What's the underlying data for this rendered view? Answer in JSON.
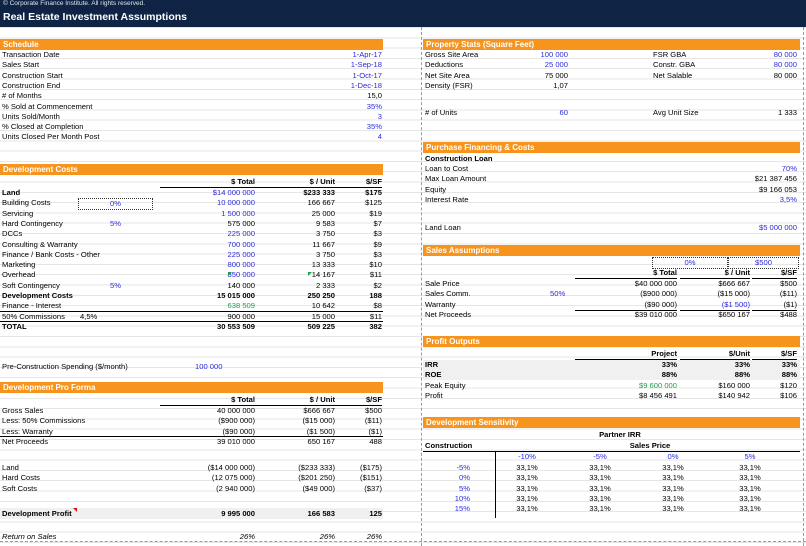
{
  "header": {
    "copyright": "© Corporate Finance Institute. All rights reserved.",
    "title": "Real Estate Investment Assumptions"
  },
  "schedule": {
    "title": "Schedule",
    "rows": [
      {
        "label": "Transaction Date",
        "value": "1-Apr-17",
        "blue": true
      },
      {
        "label": "Sales Start",
        "value": "1-Sep-18",
        "blue": true
      },
      {
        "label": "Construction Start",
        "value": "1-Oct-17",
        "blue": true
      },
      {
        "label": "Construction End",
        "value": "1-Dec-18",
        "blue": true
      },
      {
        "label": "# of Months",
        "value": "15,0",
        "blue": false
      },
      {
        "label": "% Sold at Commencement",
        "value": "35%",
        "blue": true
      },
      {
        "label": "Units Sold/Month",
        "value": "3",
        "blue": true
      },
      {
        "label": "% Closed at Completion",
        "value": "35%",
        "blue": true
      },
      {
        "label": "Units Closed Per Month Post",
        "value": "4",
        "blue": true
      }
    ]
  },
  "dev_costs": {
    "title": "Development Costs",
    "headers": [
      "$ Total",
      "$ / Unit",
      "$/SF"
    ],
    "land": {
      "label": "Land",
      "total": "$14 000 000",
      "unit": "$233 333",
      "sf": "$175"
    },
    "rows": [
      {
        "label": "Building Costs",
        "pct": "0%",
        "total": "10 000 000",
        "unit": "166 667",
        "sf": "$125",
        "blue": true
      },
      {
        "label": "Servicing",
        "pct": "",
        "total": "1 500 000",
        "unit": "25 000",
        "sf": "$19",
        "blue": true
      },
      {
        "label": "Hard Contingency",
        "pct": "5%",
        "total": "575 000",
        "unit": "9 583",
        "sf": "$7",
        "blue": false
      },
      {
        "label": "DCCs",
        "pct": "",
        "total": "225 000",
        "unit": "3 750",
        "sf": "$3",
        "blue": true
      },
      {
        "label": "Consulting & Warranty",
        "pct": "",
        "total": "700 000",
        "unit": "11 667",
        "sf": "$9",
        "blue": true
      },
      {
        "label": "Finance / Bank Costs - Other",
        "pct": "",
        "total": "225 000",
        "unit": "3 750",
        "sf": "$3",
        "blue": true
      },
      {
        "label": "Marketing",
        "pct": "",
        "total": "800 000",
        "unit": "13 333",
        "sf": "$10",
        "blue": true
      },
      {
        "label": "Overhead",
        "pct": "",
        "total": "850 000",
        "unit": "14 167",
        "sf": "$11",
        "blue": true
      },
      {
        "label": "Soft Contingency",
        "pct": "5%",
        "total": "140 000",
        "unit": "2 333",
        "sf": "$2",
        "blue": false
      }
    ],
    "dev_total": {
      "label": "Development Costs",
      "total": "15 015 000",
      "unit": "250 250",
      "sf": "188"
    },
    "finance": {
      "label": "Finance - Interest",
      "total": "638 509",
      "unit": "10 642",
      "sf": "$8"
    },
    "commissions": {
      "label": "50% Commissions",
      "pct": "4,5%",
      "total": "900 000",
      "unit": "15 000",
      "sf": "$11"
    },
    "total": {
      "label": "TOTAL",
      "total": "30 553 509",
      "unit": "509 225",
      "sf": "382"
    },
    "pre_construction": {
      "label": "Pre-Construction Spending ($/month)",
      "value": "100 000"
    }
  },
  "pro_forma": {
    "title": "Development Pro Forma",
    "headers": [
      "$ Total",
      "$ / Unit",
      "$/SF"
    ],
    "rows": [
      {
        "label": "Gross Sales",
        "total": "40 000 000",
        "unit": "$666 667",
        "sf": "$500"
      },
      {
        "label": "Less: 50% Commissions",
        "total": "($900 000)",
        "unit": "($15 000)",
        "sf": "($11)"
      },
      {
        "label": "Less: Warranty",
        "total": "($90 000)",
        "unit": "($1 500)",
        "sf": "($1)"
      },
      {
        "label": "Net Proceeds",
        "total": "39 010 000",
        "unit": "650 167",
        "sf": "488"
      }
    ],
    "costs": [
      {
        "label": "Land",
        "total": "($14 000 000)",
        "unit": "($233 333)",
        "sf": "($175)"
      },
      {
        "label": "Hard Costs",
        "total": "(12 075 000)",
        "unit": "($201 250)",
        "sf": "($151)"
      },
      {
        "label": "Soft Costs",
        "total": "(2 940 000)",
        "unit": "($49 000)",
        "sf": "($37)"
      }
    ],
    "profit": {
      "label": "Development Profit",
      "total": "9 995 000",
      "unit": "166 583",
      "sf": "125"
    },
    "ros": {
      "label": "Return on Sales",
      "total": "26%",
      "unit": "26%",
      "sf": "26%"
    }
  },
  "property": {
    "title": "Property Stats (Square Feet)",
    "left": [
      {
        "label": "Gross Site Area",
        "value": "100 000",
        "blue": true
      },
      {
        "label": "Deductions",
        "value": "25 000",
        "blue": true
      },
      {
        "label": "Net Site Area",
        "value": "75 000",
        "blue": false
      },
      {
        "label": "Density (FSR)",
        "value": "1,07",
        "blue": false
      }
    ],
    "right": [
      {
        "label": "FSR GBA",
        "value": "80 000",
        "blue": true
      },
      {
        "label": "Constr. GBA",
        "value": "80 000",
        "blue": true
      },
      {
        "label": "Net Salable",
        "value": "80 000",
        "blue": false
      }
    ],
    "units": {
      "label": "# of Units",
      "value": "60"
    },
    "unit_size": {
      "label": "Avg Unit Size",
      "value": "1 333"
    }
  },
  "financing": {
    "title": "Purchase Financing & Costs",
    "subtitle": "Construction Loan",
    "rows": [
      {
        "label": "Loan to Cost",
        "value": "70%",
        "blue": true
      },
      {
        "label": "Max Loan Amount",
        "value": "$21 387 456",
        "blue": false
      },
      {
        "label": "Equity",
        "value": "$9 166 053",
        "blue": false
      },
      {
        "label": "Interest Rate",
        "value": "3,5%",
        "blue": true
      }
    ],
    "land_loan": {
      "label": "Land Loan",
      "value": "$5 000 000"
    }
  },
  "sales": {
    "title": "Sales Assumptions",
    "inputs": [
      "0%",
      "$500"
    ],
    "headers": [
      "$ Total",
      "$ / Unit",
      "$/SF"
    ],
    "rows": [
      {
        "label": "Sale Price",
        "pct": "",
        "total": "$40 000 000",
        "unit": "$666 667",
        "sf": "$500"
      },
      {
        "label": "Sales Comm.",
        "pct": "50%",
        "total": "($900 000)",
        "unit": "($15 000)",
        "sf": "($11)"
      },
      {
        "label": "Warranty",
        "pct": "",
        "total": "($90 000)",
        "unit": "($1 500)",
        "sf": "($1)"
      },
      {
        "label": "Net Proceeds",
        "pct": "",
        "total": "$39 010 000",
        "unit": "$650 167",
        "sf": "$488"
      }
    ]
  },
  "profit_outputs": {
    "title": "Profit Outputs",
    "headers": [
      "Project",
      "$/Unit",
      "$/SF"
    ],
    "rows": [
      {
        "label": "IRR",
        "project": "33%",
        "unit": "33%",
        "sf": "33%",
        "bold": true
      },
      {
        "label": "ROE",
        "project": "88%",
        "unit": "88%",
        "sf": "88%",
        "bold": true
      },
      {
        "label": "Peak Equity",
        "project": "$9 600 000",
        "unit": "$160 000",
        "sf": "$120",
        "bold": false
      },
      {
        "label": "Profit",
        "project": "$8 456 491",
        "unit": "$140 942",
        "sf": "$106",
        "bold": false
      }
    ]
  },
  "sensitivity": {
    "title": "Development Sensitivity",
    "table_title": "Partner IRR",
    "row_header": "Construction",
    "col_header": "Sales Price",
    "cols": [
      "-10%",
      "-5%",
      "0%",
      "5%"
    ],
    "rows": [
      "-5%",
      "0%",
      "5%",
      "10%",
      "15%"
    ],
    "cell": "33,1%"
  },
  "colors": {
    "header_bg": "#0f2445",
    "section_bar": "#f7941d",
    "input_blue": "#2b2bd9",
    "highlight_green": "#1aa34a"
  }
}
